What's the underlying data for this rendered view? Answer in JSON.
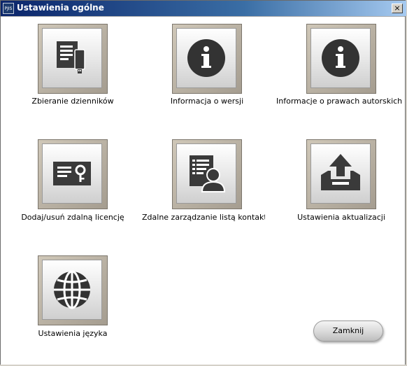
{
  "window": {
    "title": "Ustawienia ogólne",
    "app_icon_text": "PJIS",
    "close_glyph": "×"
  },
  "tiles": [
    {
      "label": "Zbieranie dzienników",
      "icon": "log-collection-icon"
    },
    {
      "label": "Informacja o wersji",
      "icon": "info-icon"
    },
    {
      "label": "Informacje o prawach autorskich",
      "icon": "info-icon"
    },
    {
      "label": "Dodaj/usuń zdalną licencję",
      "icon": "license-key-icon"
    },
    {
      "label": "Zdalne zarządzanie listą kontaktów",
      "icon": "contact-list-icon"
    },
    {
      "label": "Ustawienia aktualizacji",
      "icon": "update-upload-icon"
    },
    {
      "label": "Ustawienia języka",
      "icon": "globe-icon"
    }
  ],
  "footer": {
    "close_label": "Zamknij"
  },
  "colors": {
    "titlebar_start": "#0a246a",
    "titlebar_end": "#a6caf0",
    "icon_dark": "#3a3a3a",
    "tile_frame": "#b8b0a2"
  }
}
